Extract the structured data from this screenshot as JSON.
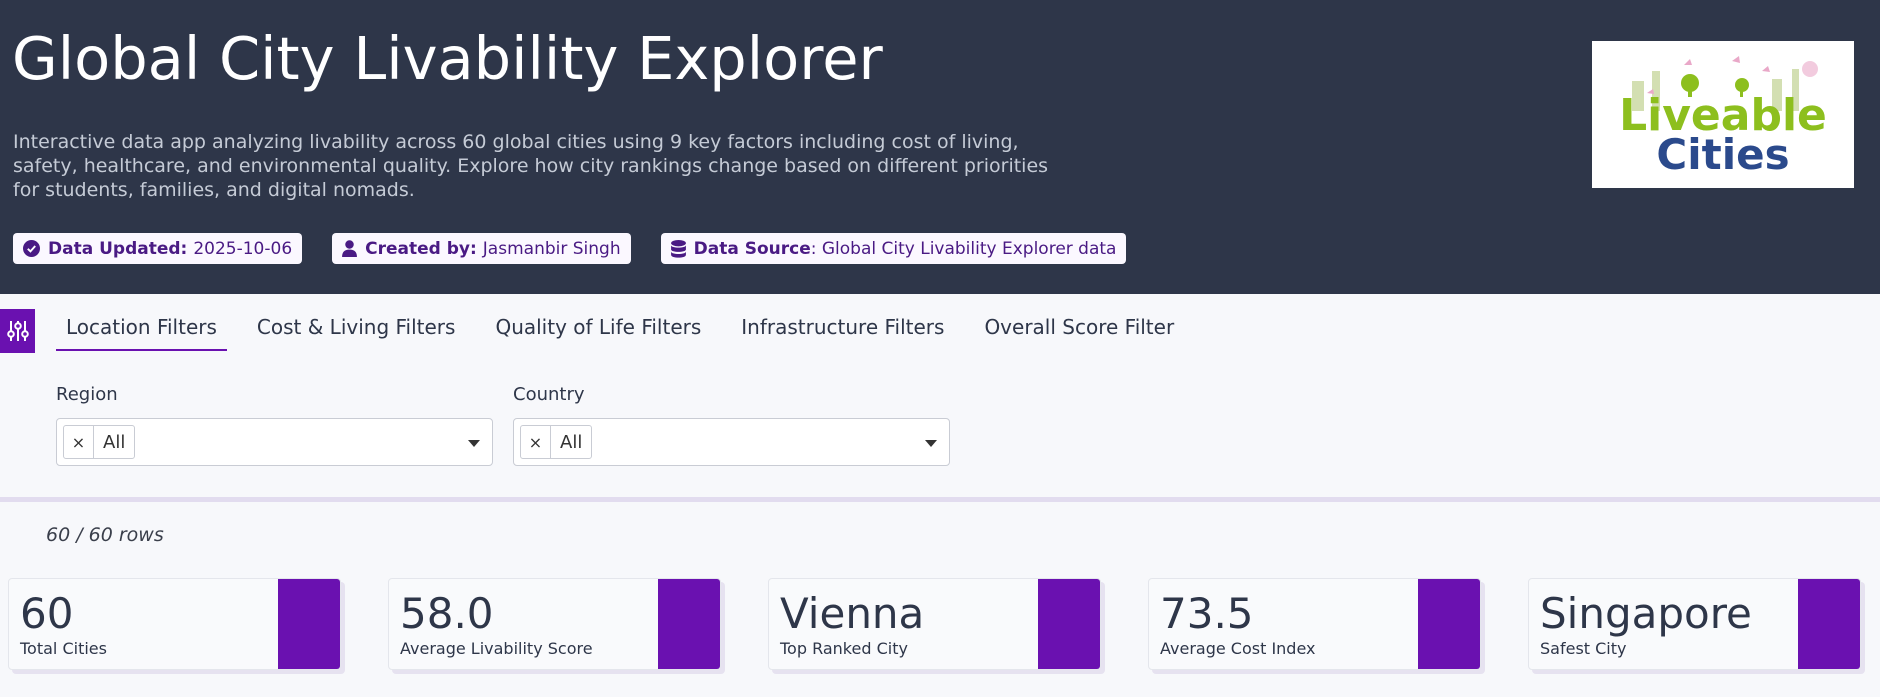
{
  "header": {
    "title": "Global City Livability Explorer",
    "description": "Interactive data app analyzing livability across 60 global cities using 9 key factors including cost of living, safety, healthcare, and environmental quality. Explore how city rankings change based on different priorities for students, families, and digital nomads.",
    "badges": [
      {
        "label": "Data Updated:",
        "value": "2025-10-06",
        "icon": "check-circle-icon"
      },
      {
        "label": "Created by:",
        "value": "Jasmanbir Singh",
        "icon": "user-icon"
      },
      {
        "label": "Data Source",
        "value": ": Global City Livability Explorer data",
        "icon": "database-icon"
      }
    ],
    "logo": {
      "line1": "Liveable",
      "line2": "Cities"
    }
  },
  "filters": {
    "tabs": [
      {
        "label": "Location Filters",
        "active": true
      },
      {
        "label": "Cost & Living Filters",
        "active": false
      },
      {
        "label": "Quality of Life Filters",
        "active": false
      },
      {
        "label": "Infrastructure Filters",
        "active": false
      },
      {
        "label": "Overall Score Filter",
        "active": false
      }
    ],
    "region": {
      "label": "Region",
      "value": "All",
      "remove": "×"
    },
    "country": {
      "label": "Country",
      "value": "All",
      "remove": "×"
    }
  },
  "rows_count": "60 / 60 rows",
  "cards": [
    {
      "value": "60",
      "label": "Total Cities"
    },
    {
      "value": "58.0",
      "label": "Average Livability Score"
    },
    {
      "value": "Vienna",
      "label": "Top Ranked City"
    },
    {
      "value": "73.5",
      "label": "Average Cost Index"
    },
    {
      "value": "Singapore",
      "label": "Safest City"
    }
  ],
  "colors": {
    "accent": "#6a11b0",
    "header_bg": "#2e3649",
    "logo_green": "#8dbf1e",
    "logo_blue": "#2b4a8c",
    "logo_pink": "#e86aa6"
  }
}
